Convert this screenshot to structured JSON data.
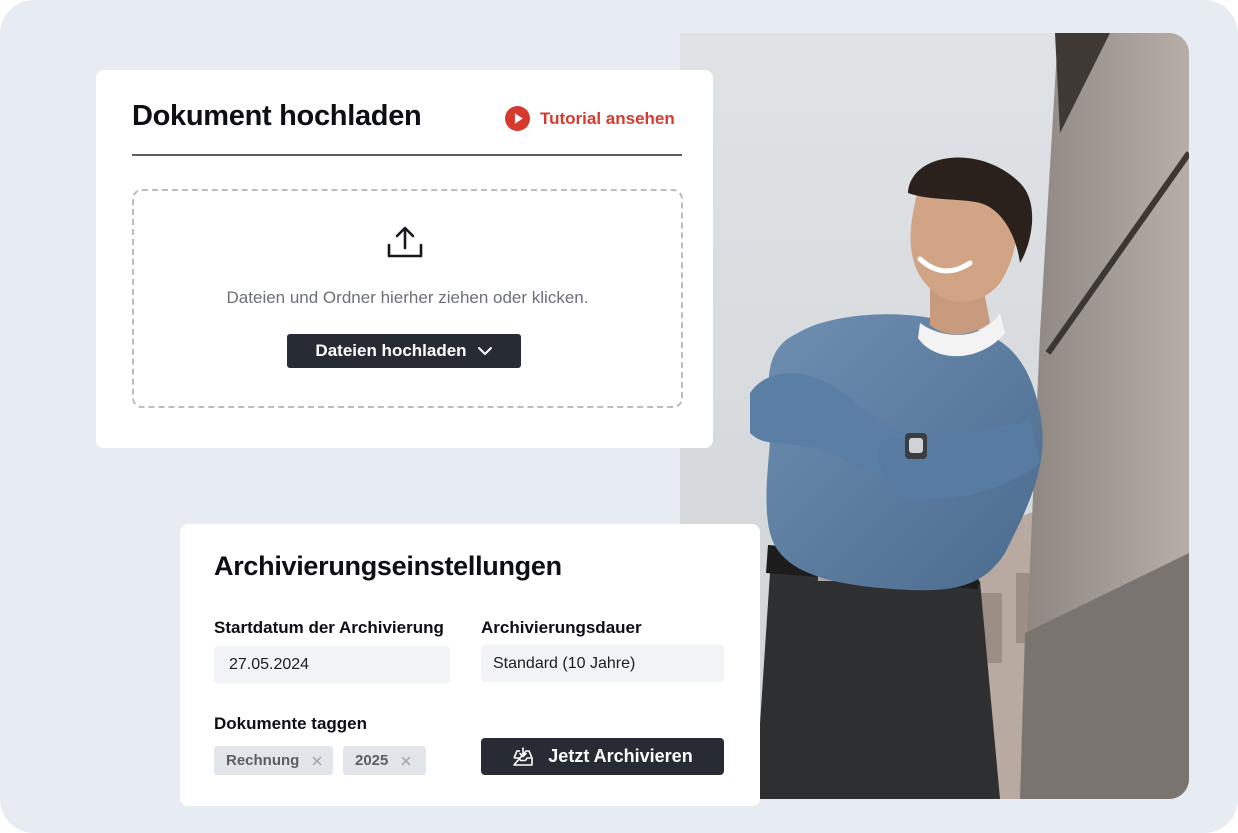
{
  "upload": {
    "title": "Dokument hochladen",
    "tutorial_label": "Tutorial ansehen",
    "drop_text": "Dateien und Ordner hierher ziehen oder klicken.",
    "upload_button_label": "Dateien hochladen",
    "icons": [
      "play-icon",
      "upload-icon",
      "chevron-down-icon"
    ]
  },
  "archive": {
    "title": "Archivierungseinstellungen",
    "start_label": "Startdatum der Archivierung",
    "start_value": "27.05.2024",
    "duration_label": "Archivierungsdauer",
    "duration_value": "Standard (10 Jahre)",
    "tags_label": "Dokumente taggen",
    "tags": [
      {
        "label": "Rechnung"
      },
      {
        "label": "2025"
      }
    ],
    "archive_button_label": "Jetzt Archivieren",
    "icons": [
      "close-icon",
      "inbox-download-icon"
    ]
  },
  "colors": {
    "page_background": "#e7ebf2",
    "accent_red": "#d63a2f",
    "button_dark": "#272b33",
    "field_background": "#f2f3f6",
    "tag_background": "#e2e5ea"
  }
}
